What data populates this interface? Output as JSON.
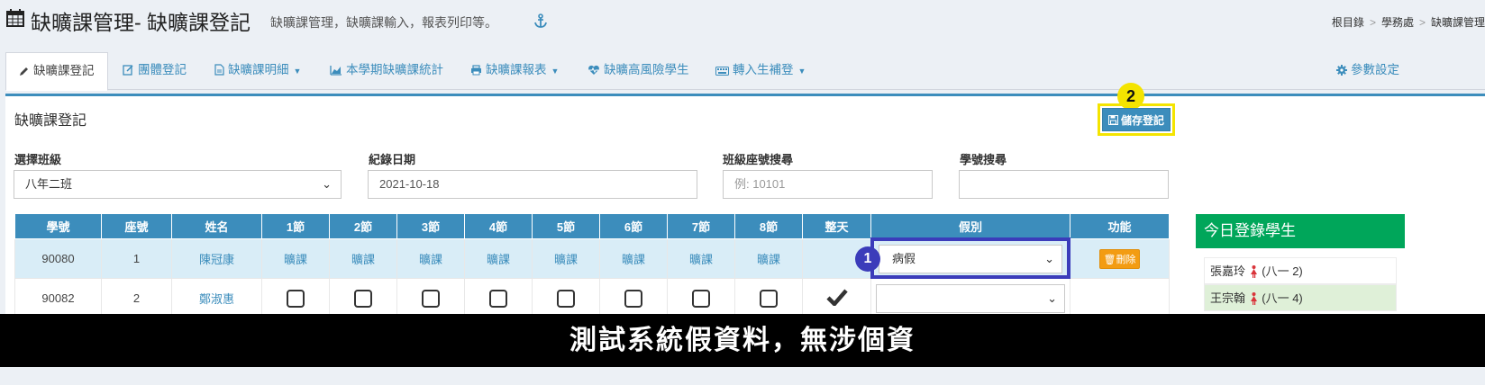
{
  "header": {
    "title": "缺曠課管理- 缺曠課登記",
    "subtitle": "缺曠課管理，缺曠課輸入，報表列印等。",
    "breadcrumb": [
      "根目錄",
      "學務處",
      "缺曠課管理"
    ]
  },
  "tabs": [
    {
      "label": "缺曠課登記",
      "icon": "pencil-icon"
    },
    {
      "label": "團體登記",
      "icon": "edit-icon"
    },
    {
      "label": "缺曠課明細",
      "icon": "file-icon",
      "dropdown": true
    },
    {
      "label": "本學期缺曠課統計",
      "icon": "area-chart-icon"
    },
    {
      "label": "缺曠課報表",
      "icon": "print-icon",
      "dropdown": true
    },
    {
      "label": "缺曠高風險學生",
      "icon": "heartbeat-icon"
    },
    {
      "label": "轉入生補登",
      "icon": "keyboard-icon",
      "dropdown": true
    },
    {
      "label": "參數設定",
      "icon": "gear-icon"
    }
  ],
  "panel": {
    "title": "缺曠課登記",
    "save_label": "儲存登記"
  },
  "filters": {
    "class_label": "選擇班級",
    "class_value": "八年二班",
    "date_label": "紀錄日期",
    "date_value": "2021-10-18",
    "seat_label": "班級座號搜尋",
    "seat_placeholder": "例: 10101",
    "student_label": "學號搜尋",
    "student_value": ""
  },
  "table": {
    "headers": [
      "學號",
      "座號",
      "姓名",
      "1節",
      "2節",
      "3節",
      "4節",
      "5節",
      "6節",
      "7節",
      "8節",
      "整天",
      "假別",
      "功能"
    ],
    "rows": [
      {
        "id": "90080",
        "seat": "1",
        "name": "陳冠康",
        "periods": [
          "曠課",
          "曠課",
          "曠課",
          "曠課",
          "曠課",
          "曠課",
          "曠課",
          "曠課"
        ],
        "leave": "病假",
        "action": "刪除"
      },
      {
        "id": "90082",
        "seat": "2",
        "name": "鄭淑惠",
        "periods": [
          "",
          "",
          "",
          "",
          "",
          "",
          "",
          ""
        ],
        "leave": "",
        "action": ""
      }
    ]
  },
  "sidebar": {
    "title": "今日登錄學生",
    "items": [
      {
        "name": "張嘉玲",
        "cls": "(八一 2)"
      },
      {
        "name": "王宗翰",
        "cls": "(八一 4)"
      }
    ]
  },
  "annotations": {
    "badge1": "1",
    "badge2": "2"
  },
  "banner": "測試系統假資料，無涉個資",
  "colors": {
    "primary": "#3c8dbc",
    "success": "#00a65a",
    "warning": "#f39c12",
    "highlight_yellow": "#f4e400",
    "highlight_blue": "#3b3cba"
  }
}
